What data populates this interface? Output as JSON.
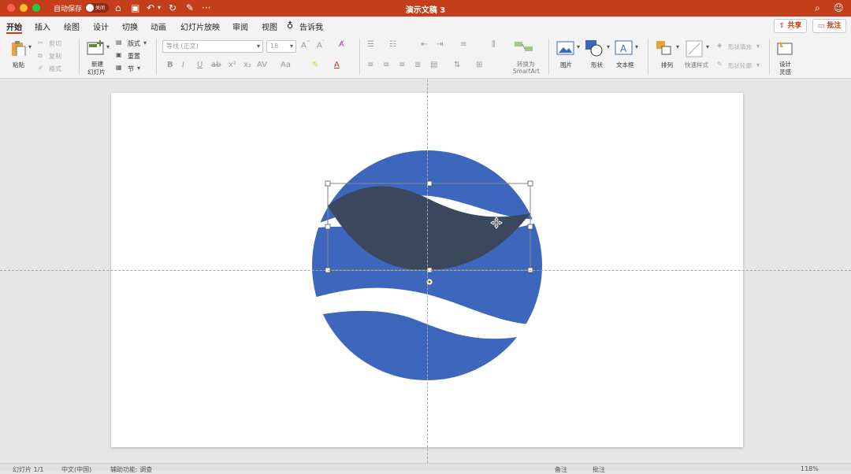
{
  "titlebar": {
    "autosave_label": "自动保存",
    "autosave_state": "关闭",
    "doc_title": "演示文稿 3",
    "more": "···"
  },
  "tabs": [
    "开始",
    "插入",
    "绘图",
    "设计",
    "切换",
    "动画",
    "幻灯片放映",
    "审阅",
    "视图"
  ],
  "tell_me": "告诉我",
  "share": "共享",
  "comments": "批注",
  "ribbon": {
    "paste": "粘贴",
    "cut": "剪切",
    "copy": "复制",
    "format_painter": "格式",
    "new_slide_1": "新建",
    "new_slide_2": "幻灯片",
    "layout": "版式",
    "reset": "重置",
    "section": "节",
    "font_name": "等线 (正文)",
    "font_size": "18",
    "bold": "B",
    "italic": "I",
    "underline": "U",
    "strike": "ab",
    "superscript": "x²",
    "subscript": "x₂",
    "char_spacing": "AV",
    "change_case": "Aa",
    "convert_smartart_1": "转换为",
    "convert_smartart_2": "SmartArt",
    "picture": "图片",
    "shape": "形状",
    "textbox": "文本框",
    "arrange": "排列",
    "quick_styles": "快速样式",
    "shape_fill": "形状填充",
    "shape_outline": "形状轮廓",
    "design_ideas_1": "设计",
    "design_ideas_2": "灵感"
  },
  "status": {
    "slide_info": "幻灯片 1/1",
    "language": "中文(中国)",
    "accessibility": "辅助功能: 调查",
    "notes": "备注",
    "comments": "批注",
    "zoom": "118%"
  },
  "colors": {
    "accent": "#c43e1c",
    "shape_blue": "#3d66bd",
    "shape_dark": "#3a475d"
  }
}
